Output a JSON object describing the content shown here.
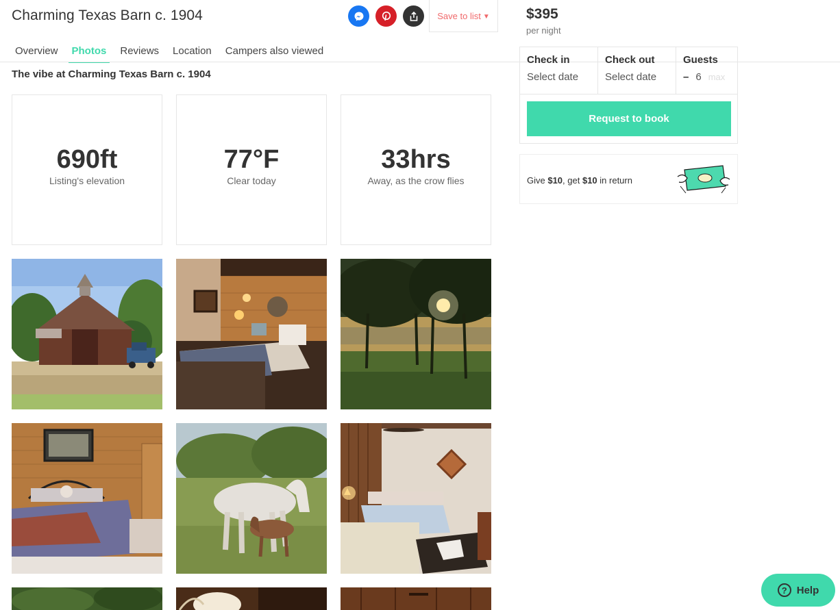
{
  "listing": {
    "title": "Charming Texas Barn c. 1904"
  },
  "share": {
    "save_label": "Save to list"
  },
  "tabs": [
    {
      "label": "Overview"
    },
    {
      "label": "Photos"
    },
    {
      "label": "Reviews"
    },
    {
      "label": "Location"
    },
    {
      "label": "Campers also viewed"
    }
  ],
  "vibe": {
    "heading": "The vibe at Charming Texas Barn c. 1904",
    "stats": [
      {
        "value": "690ft",
        "label": "Listing's elevation"
      },
      {
        "value": "77°F",
        "label": "Clear today"
      },
      {
        "value": "33hrs",
        "label": "Away, as the crow flies"
      }
    ]
  },
  "booking": {
    "price": "$395",
    "per_night": "per night",
    "check_in_label": "Check in",
    "check_in_value": "Select date",
    "check_out_label": "Check out",
    "check_out_value": "Select date",
    "guests_label": "Guests",
    "guests_minus": "–",
    "guests_count": "6",
    "guests_max": "max",
    "request_label": "Request to book"
  },
  "referral": {
    "prefix": "Give ",
    "give": "$10",
    "middle": ", get ",
    "get": "$10",
    "suffix": " in return"
  },
  "help": {
    "label": "Help",
    "icon": "?"
  },
  "colors": {
    "accent": "#40d9ac",
    "save": "#f0696b",
    "messenger": "#1877f2",
    "pinterest": "#d62028"
  }
}
